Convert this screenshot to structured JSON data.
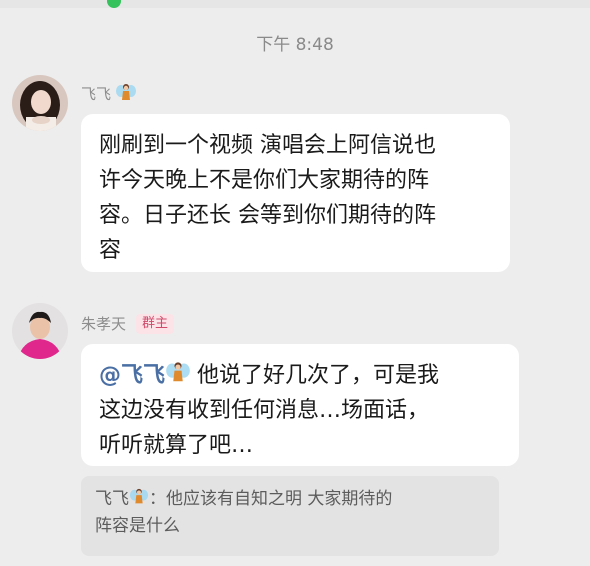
{
  "time_divider": "下午 8:48",
  "messages": [
    {
      "sender_name": "飞飞",
      "sender_emoji": "fairy-icon",
      "lines": [
        "刚刷到一个视频 演唱会上阿信说也",
        "许今天晚上不是你们大家期待的阵",
        "容。日子还长 会等到你们期待的阵",
        "容"
      ]
    },
    {
      "sender_name": "朱孝天",
      "badge": "群主",
      "mention": "@飞飞",
      "lines": [
        "他说了好几次了，可是我",
        "这边没有收到任何消息…场面话，",
        "听听就算了吧…"
      ],
      "quote": {
        "author": "飞飞",
        "separator": "：",
        "lines": [
          "他应该有自知之明  大家期待的",
          "阵容是什么"
        ]
      }
    }
  ],
  "colors": {
    "background": "#ededed",
    "bubble": "#ffffff",
    "quote": "#e3e3e3",
    "badge_text": "#d04a6a",
    "mention": "#4a6fa5"
  }
}
